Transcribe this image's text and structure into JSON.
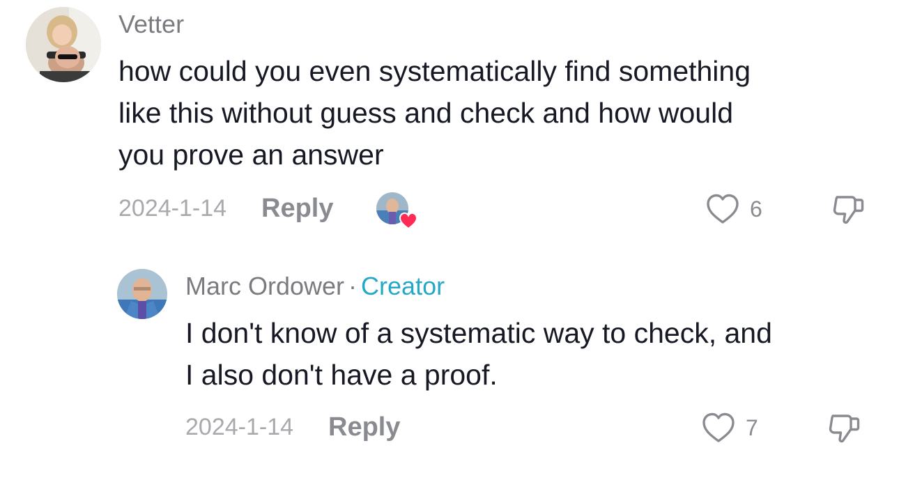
{
  "comments": [
    {
      "username": "Vetter",
      "text_lines": [
        "how could you even systematically find something",
        "like this without guess and check and how would",
        "you prove an answer"
      ],
      "date": "2024-1-14",
      "reply_label": "Reply",
      "like_count": "6"
    }
  ],
  "reply": {
    "username": "Marc Ordower",
    "separator": "·",
    "badge": "Creator",
    "text_lines": [
      "I don't know of a systematic way to check, and",
      "I also don't have a proof."
    ],
    "date": "2024-1-14",
    "reply_label": "Reply",
    "like_count": "7"
  },
  "colors": {
    "creator_badge": "#25a8c7",
    "creator_heart": "#fe2c55",
    "muted_text": "#8a8b91"
  }
}
